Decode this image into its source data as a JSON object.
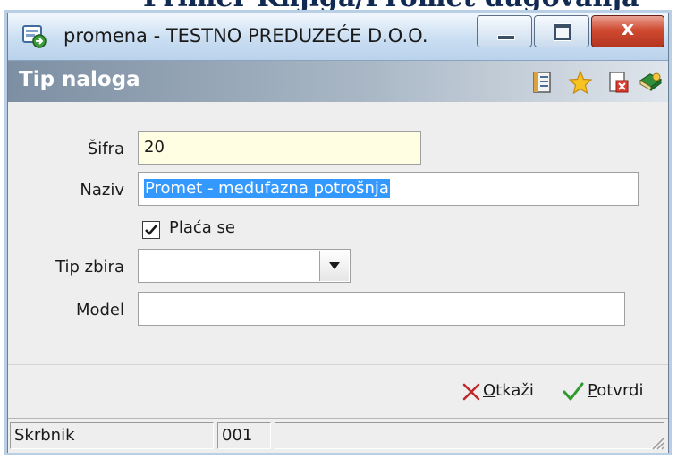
{
  "background_text": "Primer Knjiga/Promet dugovanja",
  "window": {
    "title": "promena - TESTNO PREDUZEĆE D.O.O.",
    "close_glyph": "x"
  },
  "header": {
    "title": "Tip naloga",
    "icons": [
      "list-icon",
      "star-icon",
      "export-icon",
      "help-book-icon"
    ]
  },
  "form": {
    "sifra": {
      "label": "Šifra",
      "value": "20"
    },
    "naziv": {
      "label": "Naziv",
      "value": "Promet - međufazna potrošnja",
      "selected": true
    },
    "placa_se": {
      "label": "Plaća se",
      "checked": true
    },
    "tip_zbira": {
      "label": "Tip zbira",
      "value": ""
    },
    "model": {
      "label": "Model",
      "value": ""
    }
  },
  "actions": {
    "cancel_label": "Otkaži",
    "confirm_label": "Potvrdi"
  },
  "statusbar": {
    "user": "Skrbnik",
    "code": "001",
    "extra": ""
  },
  "colors": {
    "sifra_background": "#fffde2",
    "selection": "#3399ff",
    "cancel_x": "#c0282a",
    "confirm_check": "#2e9b2e"
  }
}
